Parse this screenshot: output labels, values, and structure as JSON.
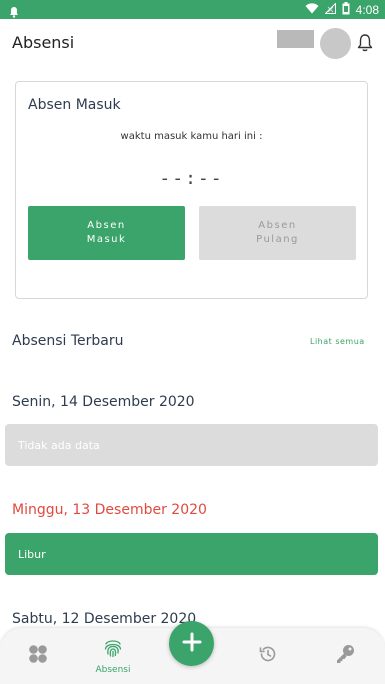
{
  "statusbar": {
    "time": "4:08",
    "icons": [
      "notification-icon",
      "wifi-icon",
      "signal-icon",
      "battery-icon"
    ]
  },
  "appbar": {
    "title": "Absensi",
    "bell_icon": "bell-icon"
  },
  "card": {
    "title": "Absen Masuk",
    "subtitle": "waktu masuk kamu hari ini :",
    "timer": "--:--",
    "btn_masuk": "Absen\nMasuk",
    "btn_pulang": "Absen\nPulang"
  },
  "recent": {
    "title": "Absensi Terbaru",
    "see_all": "Lihat semua",
    "days": [
      {
        "date": "Senin, 14 Desember 2020",
        "status": "Tidak ada data"
      },
      {
        "date": "Minggu, 13 Desember 2020",
        "status": "Libur"
      },
      {
        "date": "Sabtu, 12 Desember 2020"
      }
    ]
  },
  "nav": {
    "absensi_label": "Absensi"
  },
  "colors": {
    "primary": "#3aa46a",
    "holiday_red": "#e04a3f",
    "disabled": "#dcdcdc"
  }
}
